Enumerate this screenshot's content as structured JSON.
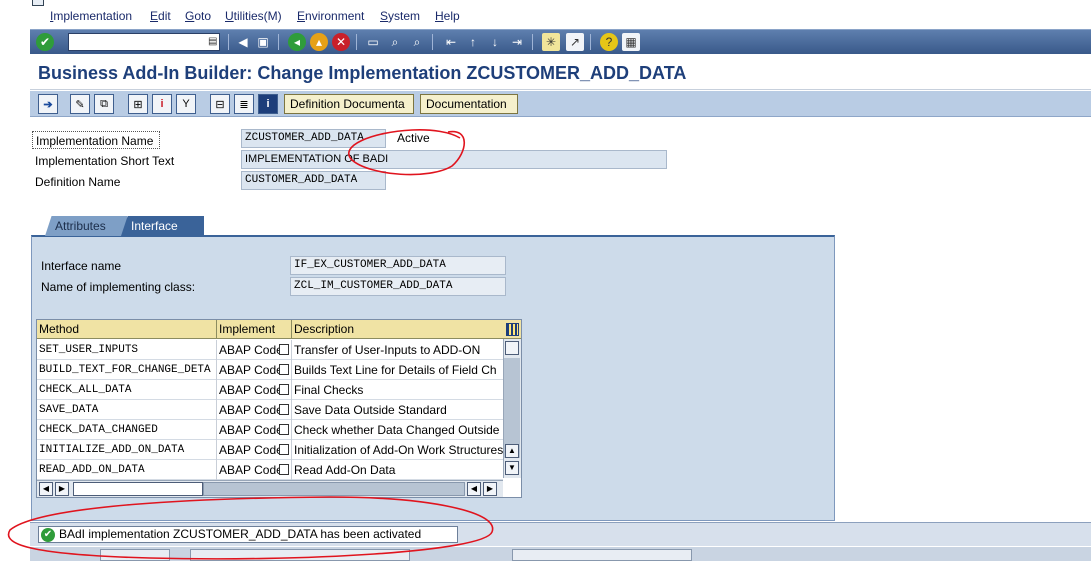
{
  "menu": [
    "Implementation",
    "Edit",
    "Goto",
    "Utilities(M)",
    "Environment",
    "System",
    "Help"
  ],
  "toolbar": {
    "command_field_value": "",
    "icons": [
      "enter-icon",
      "back-icon",
      "save-icon",
      "previous-screen-icon",
      "exit-icon",
      "cancel-icon",
      "print-icon",
      "find-icon",
      "find-next-icon",
      "first-page-icon",
      "previous-page-icon",
      "next-page-icon",
      "last-page-icon",
      "new-session-icon",
      "shortcut-icon",
      "help-icon",
      "layout-icon"
    ]
  },
  "title": "Business Add-In Builder: Change Implementation ZCUSTOMER_ADD_DATA",
  "app_toolbar": {
    "buttons": [
      "Definition Documenta",
      "Documentation"
    ]
  },
  "header_fields": {
    "impl_name_label": "Implementation Name",
    "impl_name_value": "ZCUSTOMER_ADD_DATA",
    "status": "Active",
    "short_text_label": "Implementation Short Text",
    "short_text_value": "IMPLEMENTATION OF BADI",
    "definition_label": "Definition Name",
    "definition_value": "CUSTOMER_ADD_DATA"
  },
  "tabs": [
    "Attributes",
    "Interface"
  ],
  "interface": {
    "interface_name_label": "Interface name",
    "interface_name_value": "IF_EX_CUSTOMER_ADD_DATA",
    "class_label": "Name of implementing class:",
    "class_value": "ZCL_IM_CUSTOMER_ADD_DATA"
  },
  "table": {
    "columns": [
      "Method",
      "Implement",
      "Description"
    ],
    "rows": [
      {
        "method": "SET_USER_INPUTS",
        "impl": "ABAP Code",
        "desc": "Transfer of User-Inputs to ADD-ON"
      },
      {
        "method": "BUILD_TEXT_FOR_CHANGE_DETA",
        "impl": "ABAP Code",
        "desc": "Builds Text Line for Details of Field Ch"
      },
      {
        "method": "CHECK_ALL_DATA",
        "impl": "ABAP Code",
        "desc": "Final Checks"
      },
      {
        "method": "SAVE_DATA",
        "impl": "ABAP Code",
        "desc": "Save Data Outside Standard"
      },
      {
        "method": "CHECK_DATA_CHANGED",
        "impl": "ABAP Code",
        "desc": "Check whether Data Changed Outside"
      },
      {
        "method": "INITIALIZE_ADD_ON_DATA",
        "impl": "ABAP Code",
        "desc": "Initialization of Add-On Work Structures"
      },
      {
        "method": "READ_ADD_ON_DATA",
        "impl": "ABAP Code",
        "desc": "Read Add-On Data"
      }
    ]
  },
  "status_bar": {
    "message": "BAdI implementation ZCUSTOMER_ADD_DATA has been activated"
  },
  "colors": {
    "title": "#1e3f7a",
    "annotation": "#e0141e",
    "toolbar": "#4a6a9c"
  }
}
